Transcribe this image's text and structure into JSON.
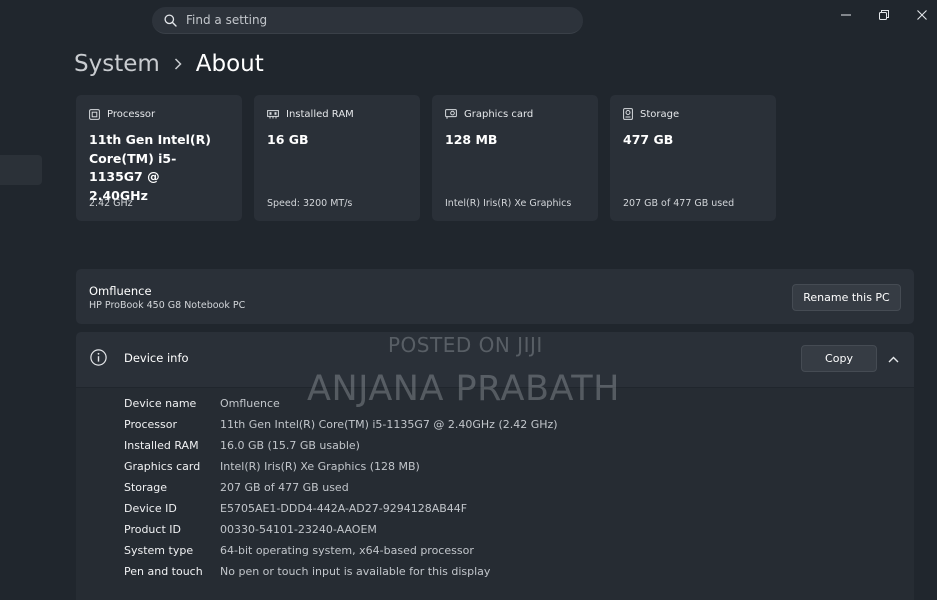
{
  "search": {
    "placeholder": "Find a setting"
  },
  "breadcrumb": {
    "parent": "System",
    "current": "About"
  },
  "cards": [
    {
      "label": "Processor",
      "value_lines": [
        "11th Gen Intel(R)",
        "Core(TM) i5-1135G7 @",
        "2.40GHz"
      ],
      "sub": "2.42 GHz",
      "icon": "processor-icon"
    },
    {
      "label": "Installed RAM",
      "value_lines": [
        "16 GB"
      ],
      "sub": "Speed: 3200 MT/s",
      "icon": "ram-icon"
    },
    {
      "label": "Graphics card",
      "value_lines": [
        "128 MB"
      ],
      "sub": "Intel(R) Iris(R) Xe Graphics",
      "icon": "graphics-card-icon"
    },
    {
      "label": "Storage",
      "value_lines": [
        "477 GB"
      ],
      "sub": "207 GB of 477 GB used",
      "icon": "storage-icon"
    }
  ],
  "pc": {
    "name": "Omfluence",
    "model": "HP ProBook 450 G8 Notebook PC",
    "rename_label": "Rename this PC"
  },
  "device_info": {
    "title": "Device info",
    "copy_label": "Copy",
    "rows": [
      {
        "key": "Device name",
        "value": "Omfluence"
      },
      {
        "key": "Processor",
        "value": "11th Gen Intel(R) Core(TM) i5-1135G7 @ 2.40GHz (2.42 GHz)"
      },
      {
        "key": "Installed RAM",
        "value": "16.0 GB (15.7 GB usable)"
      },
      {
        "key": "Graphics card",
        "value": "Intel(R) Iris(R) Xe Graphics (128 MB)"
      },
      {
        "key": "Storage",
        "value": "207 GB of 477 GB used"
      },
      {
        "key": "Device ID",
        "value": "E5705AE1-DDD4-442A-AD27-9294128AB44F"
      },
      {
        "key": "Product ID",
        "value": "00330-54101-23240-AAOEM"
      },
      {
        "key": "System type",
        "value": "64-bit operating system, x64-based processor"
      },
      {
        "key": "Pen and touch",
        "value": "No pen or touch input is available for this display"
      }
    ]
  },
  "watermark": {
    "line1": "POSTED ON JIJI",
    "line2": "ANJANA PRABATH"
  },
  "colors": {
    "background": "#20262d",
    "card": "#2a3038",
    "button": "#363c44"
  }
}
